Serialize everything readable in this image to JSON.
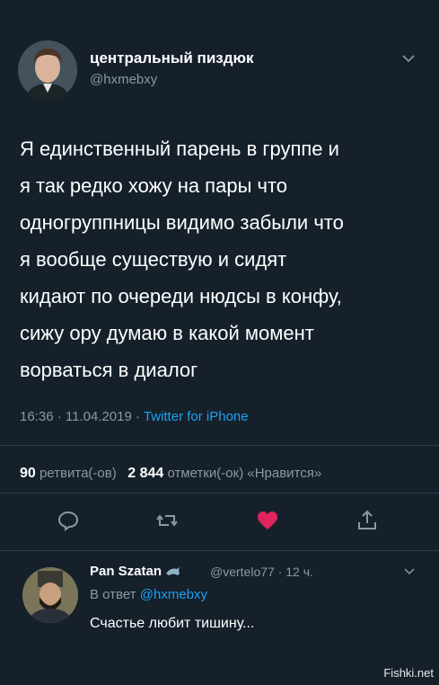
{
  "tweet": {
    "display_name": "центральный пиздюк",
    "handle": "@hxmebxy",
    "avatar_icon": "avatar-photo",
    "text": "Я единственный парень в группе и\nя так редко хожу на пары что\nодногруппницы видимо забыли что\nя вообще существую и сидят\nкидают по очереди нюдсы в конфу,\nсижу ору думаю в какой момент\nворваться в диалог",
    "time": "16:36 · 11.04.2019 · ",
    "source": "Twitter for iPhone",
    "retweets_count": "90",
    "retweets_label": " ретвита(-ов)",
    "likes_count": "2 844",
    "likes_label": " отметки(-ок) «Нравится»",
    "actions": [
      "reply-icon",
      "retweet-icon",
      "heart-icon",
      "share-icon"
    ]
  },
  "reply": {
    "display_name": "Pan Szatan",
    "name_emoji_icon": "dolphin-icon",
    "handle_time": "@vertelo77 · 12 ч.",
    "reply_to_label": "В ответ ",
    "reply_to_handle": "@hxmebxy",
    "text": "Счастье любит тишину..."
  },
  "watermark": "Fishki.net",
  "colors": {
    "background": "#15202b",
    "secondary_text": "#8899a6",
    "link": "#1da1f2",
    "like": "#e0245e"
  }
}
